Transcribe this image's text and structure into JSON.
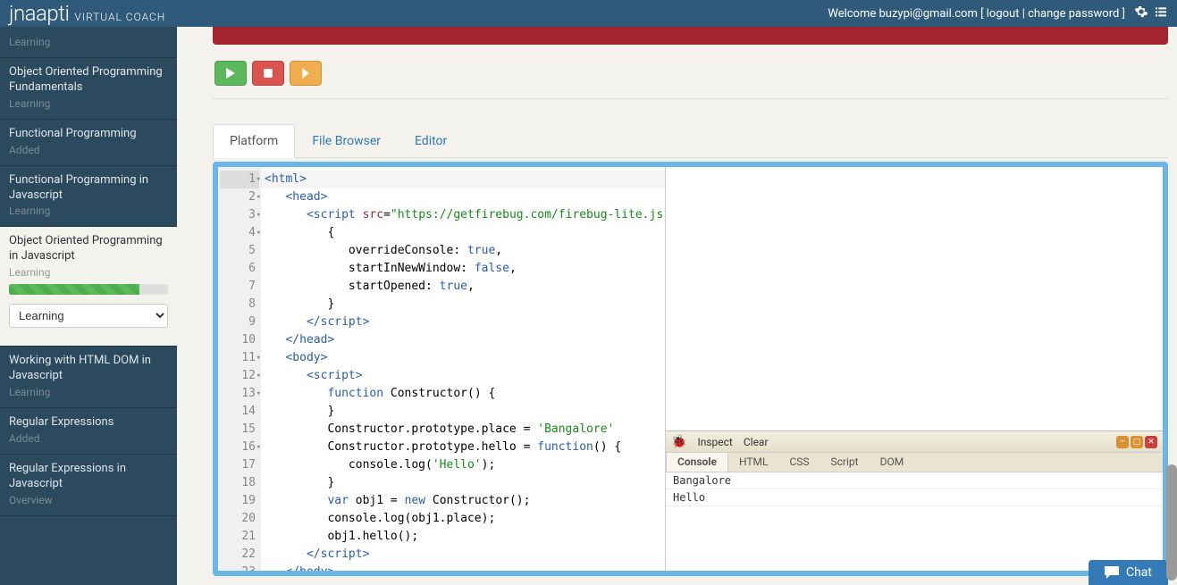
{
  "header": {
    "brand_main": "jnaapti",
    "brand_sub": "VIRTUAL COACH",
    "welcome_prefix": "Welcome ",
    "user_email": "buzypi@gmail.com",
    "logout": "logout",
    "change_password": "change password"
  },
  "sidebar": {
    "items": [
      {
        "title": "",
        "status": "Learning",
        "active": false
      },
      {
        "title": "Object Oriented Programming Fundamentals",
        "status": "Learning",
        "active": false
      },
      {
        "title": "Functional Programming",
        "status": "Added",
        "active": false
      },
      {
        "title": "Functional Programming in Javascript",
        "status": "Learning",
        "active": false
      },
      {
        "title": "Object Oriented Programming in Javascript",
        "status": "Learning",
        "active": true,
        "progress": 82
      },
      {
        "title": "Working with HTML DOM in Javascript",
        "status": "Learning",
        "active": false
      },
      {
        "title": "Regular Expressions",
        "status": "Added",
        "active": false
      },
      {
        "title": "Regular Expressions in Javascript",
        "status": "Overview",
        "active": false
      }
    ],
    "select_value": "Learning"
  },
  "tabs": {
    "platform": "Platform",
    "file_browser": "File Browser",
    "editor": "Editor"
  },
  "code_lines": [
    {
      "n": 1,
      "fold": true,
      "active": true,
      "html": "<span class='tag'>&lt;html&gt;</span>"
    },
    {
      "n": 2,
      "fold": true,
      "html": "   <span class='tag'>&lt;head&gt;</span>"
    },
    {
      "n": 3,
      "fold": true,
      "html": "      <span class='tag'>&lt;script</span> <span class='attr'>src</span>=<span class='str'>\"https://getfirebug.com/firebug-lite.js\"</span><span class='tag'>&gt;</span>"
    },
    {
      "n": 4,
      "fold": true,
      "html": "         {"
    },
    {
      "n": 5,
      "html": "            overrideConsole: <span class='lit'>true</span>,"
    },
    {
      "n": 6,
      "html": "            startInNewWindow: <span class='lit'>false</span>,"
    },
    {
      "n": 7,
      "html": "            startOpened: <span class='lit'>true</span>,"
    },
    {
      "n": 8,
      "html": "         }"
    },
    {
      "n": 9,
      "html": "      <span class='tag'>&lt;/script&gt;</span>"
    },
    {
      "n": 10,
      "html": "   <span class='tag'>&lt;/head&gt;</span>"
    },
    {
      "n": 11,
      "fold": true,
      "html": "   <span class='tag'>&lt;body&gt;</span>"
    },
    {
      "n": 12,
      "fold": true,
      "html": "      <span class='tag'>&lt;script&gt;</span>"
    },
    {
      "n": 13,
      "fold": true,
      "html": "         <span class='kw'>function</span> Constructor() {"
    },
    {
      "n": 14,
      "html": "         }"
    },
    {
      "n": 15,
      "html": "         Constructor.prototype.place = <span class='str'>'Bangalore'</span>"
    },
    {
      "n": 16,
      "fold": true,
      "html": "         Constructor.prototype.hello = <span class='kw'>function</span>() {"
    },
    {
      "n": 17,
      "html": "            console.log(<span class='str'>'Hello'</span>);"
    },
    {
      "n": 18,
      "html": "         }"
    },
    {
      "n": 19,
      "html": "         <span class='kw'>var</span> obj1 = <span class='kw'>new</span> Constructor();"
    },
    {
      "n": 20,
      "html": "         console.log(obj1.place);"
    },
    {
      "n": 21,
      "html": "         obj1.hello();"
    },
    {
      "n": 22,
      "html": "      <span class='tag'>&lt;/script&gt;</span>"
    },
    {
      "n": 23,
      "html": "   <span class='tag'>&lt;/body&gt;</span>"
    }
  ],
  "firebug": {
    "inspect": "Inspect",
    "clear": "Clear",
    "tabs": {
      "console": "Console",
      "html": "HTML",
      "css": "CSS",
      "script": "Script",
      "dom": "DOM"
    },
    "logs": [
      "Bangalore",
      "Hello"
    ]
  },
  "chat_label": "Chat"
}
